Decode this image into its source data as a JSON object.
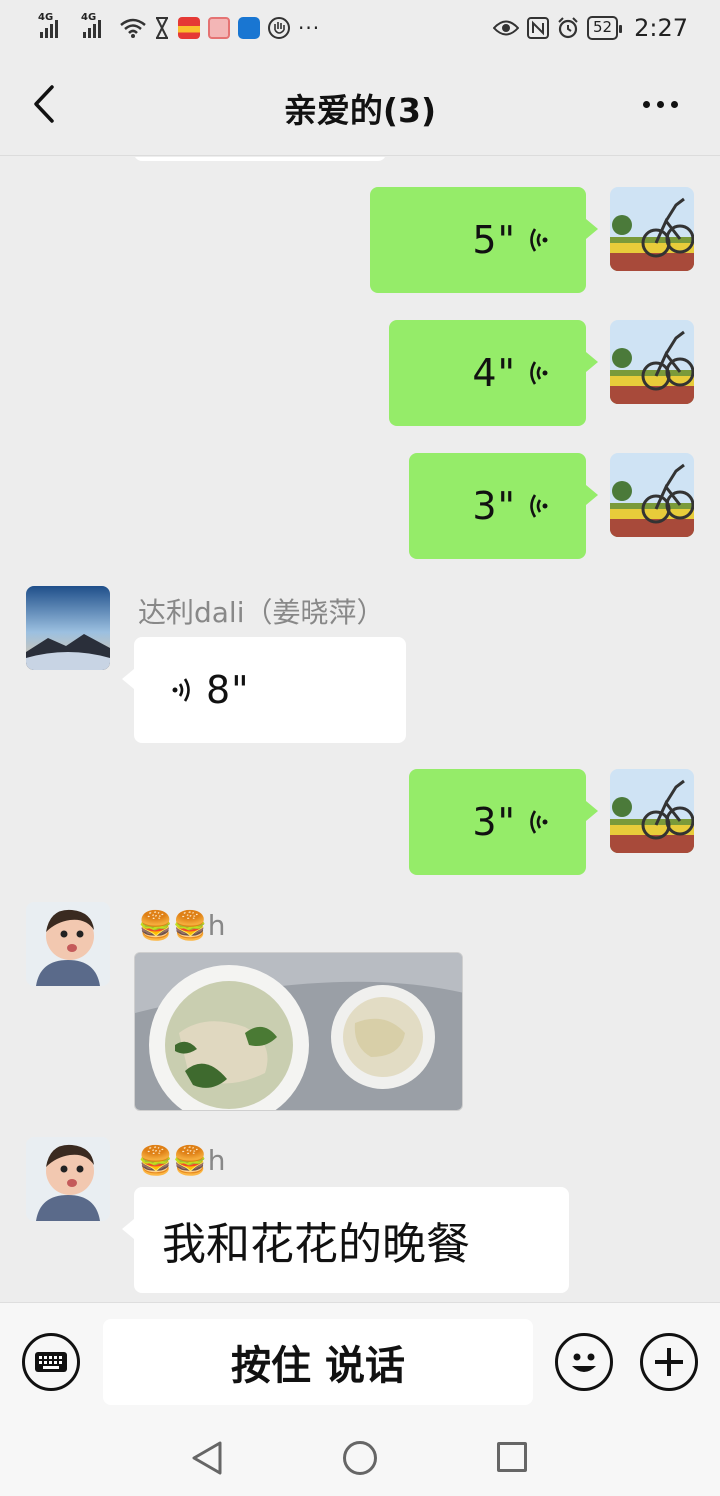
{
  "status_bar": {
    "net1": "4G",
    "net2": "4G",
    "battery": "52",
    "time": "2:27"
  },
  "header": {
    "title": "亲爱的(3)"
  },
  "messages": [
    {
      "direction": "out",
      "type": "voice",
      "duration": "5\""
    },
    {
      "direction": "out",
      "type": "voice",
      "duration": "4\""
    },
    {
      "direction": "out",
      "type": "voice",
      "duration": "3\""
    },
    {
      "direction": "in",
      "type": "voice",
      "sender": "达利dali（姜晓萍）",
      "duration": "8\""
    },
    {
      "direction": "out",
      "type": "voice",
      "duration": "3\""
    },
    {
      "direction": "in",
      "type": "image",
      "sender": "🍔🍔h"
    },
    {
      "direction": "in",
      "type": "text",
      "sender": "🍔🍔h",
      "text": "我和花花的晚餐"
    }
  ],
  "input_bar": {
    "hold_to_talk": "按住 说话"
  },
  "colors": {
    "outgoing_bubble": "#95ec69",
    "incoming_bubble": "#ffffff",
    "background": "#ededed"
  },
  "icons": [
    "back-arrow-icon",
    "more-dots-icon",
    "voice-wave-icon",
    "keyboard-icon",
    "emoji-icon",
    "plus-icon"
  ]
}
